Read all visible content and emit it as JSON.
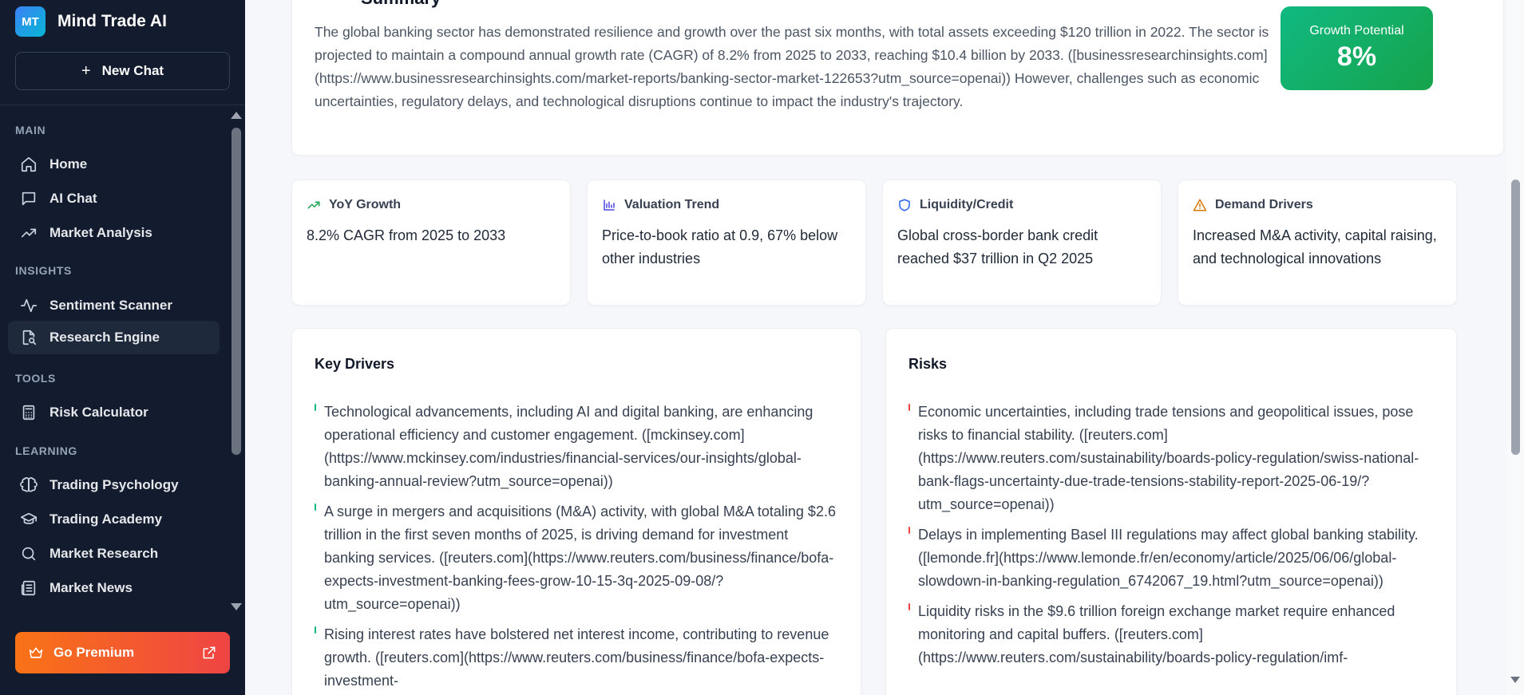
{
  "app": {
    "logo_text": "MT",
    "name": "Mind Trade AI",
    "new_chat_label": "New Chat",
    "premium_label": "Go Premium"
  },
  "sidebar": {
    "sections": [
      {
        "title": "MAIN",
        "items": [
          {
            "label": "Home",
            "icon": "home-icon"
          },
          {
            "label": "AI Chat",
            "icon": "chat-icon"
          },
          {
            "label": "Market Analysis",
            "icon": "trend-up-icon"
          }
        ]
      },
      {
        "title": "INSIGHTS",
        "items": [
          {
            "label": "Sentiment Scanner",
            "icon": "pulse-icon"
          },
          {
            "label": "Research Engine",
            "icon": "document-search-icon",
            "active": true
          }
        ]
      },
      {
        "title": "TOOLS",
        "items": [
          {
            "label": "Risk Calculator",
            "icon": "calculator-icon"
          }
        ]
      },
      {
        "title": "LEARNING",
        "items": [
          {
            "label": "Trading Psychology",
            "icon": "brain-icon"
          },
          {
            "label": "Trading Academy",
            "icon": "graduation-cap-icon"
          },
          {
            "label": "Market Research",
            "icon": "search-icon"
          },
          {
            "label": "Market News",
            "icon": "newspaper-icon"
          }
        ]
      }
    ]
  },
  "summary": {
    "title": "Summary",
    "text": "The global banking sector has demonstrated resilience and growth over the past six months, with total assets exceeding $120 trillion in 2022. The sector is projected to maintain a compound annual growth rate (CAGR) of 8.2% from 2025 to 2033, reaching $10.4 billion by 2033. ([businessresearchinsights.com](https://www.businessresearchinsights.com/market-reports/banking-sector-market-122653?utm_source=openai)) However, challenges such as economic uncertainties, regulatory delays, and technological disruptions continue to impact the industry's trajectory.",
    "growth_label": "Growth Potential",
    "growth_value": "8%"
  },
  "metrics": [
    {
      "title": "YoY Growth",
      "icon": "trend-up-icon",
      "color": "#16a34a",
      "text": "8.2% CAGR from 2025 to 2033"
    },
    {
      "title": "Valuation Trend",
      "icon": "bar-chart-icon",
      "color": "#4f46e5",
      "text": "Price-to-book ratio at 0.9, 67% below other industries"
    },
    {
      "title": "Liquidity/Credit",
      "icon": "shield-icon",
      "color": "#2563eb",
      "text": "Global cross-border bank credit reached $37 trillion in Q2 2025"
    },
    {
      "title": "Demand Drivers",
      "icon": "warning-icon",
      "color": "#d97706",
      "text": "Increased M&A activity, capital raising, and technological innovations"
    }
  ],
  "key_drivers": {
    "title": "Key Drivers",
    "accent": "#10b981",
    "items": [
      "Technological advancements, including AI and digital banking, are enhancing operational efficiency and customer engagement. ([mckinsey.com](https://www.mckinsey.com/industries/financial-services/our-insights/global-banking-annual-review?utm_source=openai))",
      "A surge in mergers and acquisitions (M&A) activity, with global M&A totaling $2.6 trillion in the first seven months of 2025, is driving demand for investment banking services. ([reuters.com](https://www.reuters.com/business/finance/bofa-expects-investment-banking-fees-grow-10-15-3q-2025-09-08/?utm_source=openai))",
      "Rising interest rates have bolstered net interest income, contributing to revenue growth. ([reuters.com](https://www.reuters.com/business/finance/bofa-expects-investment-"
    ]
  },
  "risks": {
    "title": "Risks",
    "accent": "#ef4444",
    "items": [
      "Economic uncertainties, including trade tensions and geopolitical issues, pose risks to financial stability. ([reuters.com](https://www.reuters.com/sustainability/boards-policy-regulation/swiss-national-bank-flags-uncertainty-due-trade-tensions-stability-report-2025-06-19/?utm_source=openai))",
      "Delays in implementing Basel III regulations may affect global banking stability. ([lemonde.fr](https://www.lemonde.fr/en/economy/article/2025/06/06/global-slowdown-in-banking-regulation_6742067_19.html?utm_source=openai))",
      "Liquidity risks in the $9.6 trillion foreign exchange market require enhanced monitoring and capital buffers. ([reuters.com](https://www.reuters.com/sustainability/boards-policy-regulation/imf-"
    ]
  }
}
